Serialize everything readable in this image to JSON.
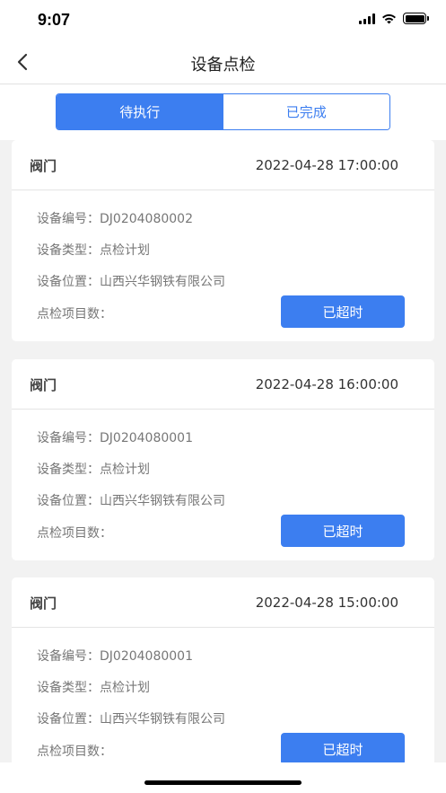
{
  "status": {
    "time": "9:07"
  },
  "nav": {
    "title": "设备点检"
  },
  "tabs": [
    {
      "label": "待执行",
      "active": true
    },
    {
      "label": "已完成",
      "active": false
    }
  ],
  "labels": {
    "code": "设备编号：",
    "type": "设备类型：",
    "location": "设备位置：",
    "items": "点检项目数："
  },
  "cards": [
    {
      "name": "阀门",
      "time": "2022-04-28 17:00:00",
      "code": "DJ0204080002",
      "type": "点检计划",
      "location": "山西兴华钢铁有限公司",
      "items": "",
      "button": "已超时"
    },
    {
      "name": "阀门",
      "time": "2022-04-28 16:00:00",
      "code": "DJ0204080001",
      "type": "点检计划",
      "location": "山西兴华钢铁有限公司",
      "items": "",
      "button": "已超时"
    },
    {
      "name": "阀门",
      "time": "2022-04-28 15:00:00",
      "code": "DJ0204080001",
      "type": "点检计划",
      "location": "山西兴华钢铁有限公司",
      "items": "",
      "button": "已超时"
    }
  ],
  "colors": {
    "accent": "#3c7ef0",
    "background": "#f2f2f2"
  }
}
